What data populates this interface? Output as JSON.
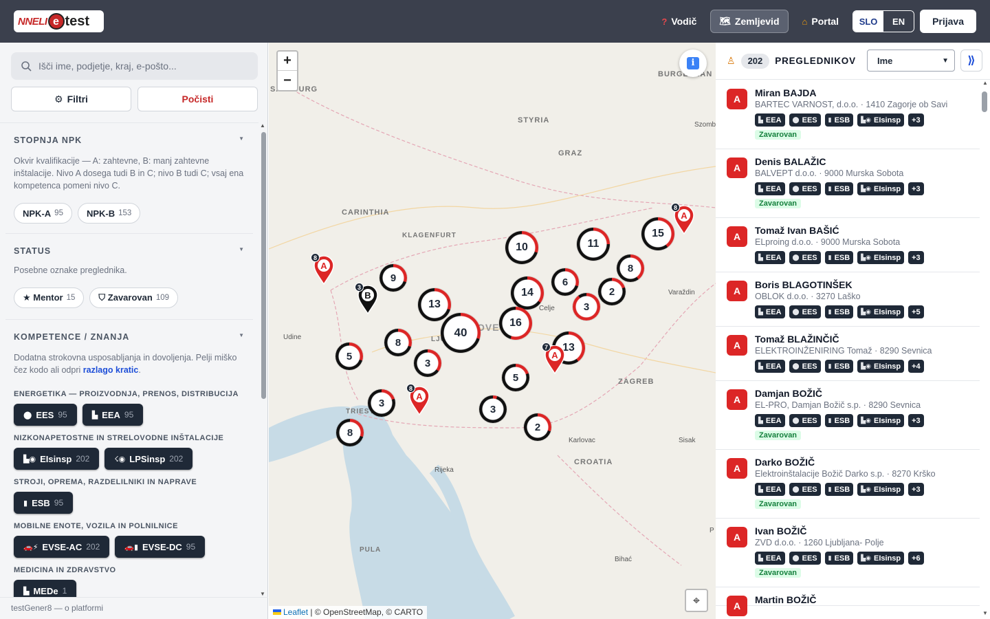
{
  "header": {
    "logo_text_1": "NNELI",
    "logo_pin": "e",
    "logo_text_2": "test",
    "nav": [
      {
        "label": "Vodič",
        "icon": "question-icon",
        "active": false
      },
      {
        "label": "Zemljevid",
        "icon": "map-icon",
        "active": true
      },
      {
        "label": "Portal",
        "icon": "home-icon",
        "active": false
      }
    ],
    "lang_active": "SLO",
    "lang_other": "EN",
    "login": "Prijava"
  },
  "sidebar": {
    "search_placeholder": "Išči ime, podjetje, kraj, e-pošto...",
    "filters_button": "Filtri",
    "clear_button": "Počisti",
    "npk": {
      "title": "STOPNJA NPK",
      "desc": "Okvir kvalifikacije — A: zahtevne, B: manj zahtevne inštalacije. Nivo A dosega tudi B in C; nivo B tudi C; vsaj ena kompetenca pomeni nivo C.",
      "chips": [
        {
          "label": "NPK-A",
          "count": "95"
        },
        {
          "label": "NPK-B",
          "count": "153"
        }
      ]
    },
    "status": {
      "title": "STATUS",
      "desc": "Posebne oznake preglednika.",
      "chips": [
        {
          "label": "★ Mentor",
          "count": "15"
        },
        {
          "label": "⛉ Zavarovan",
          "count": "109"
        }
      ]
    },
    "komp": {
      "title": "KOMPETENCE / ZNANJA",
      "desc_1": "Dodatna strokovna usposabljanja in dovoljenja. Pelji miško čez kodo ali odpri ",
      "desc_link": "razlago kratic",
      "desc_2": ".",
      "groups": [
        {
          "title": "ENERGETIKA — PROIZVODNJA, PRENOS, DISTRIBUCIJA",
          "items": [
            {
              "label": "EES",
              "count": "95"
            },
            {
              "label": "EEA",
              "count": "95"
            }
          ]
        },
        {
          "title": "NIZKONAPETOSTNE IN STRELOVODNE INŠTALACIJE",
          "items": [
            {
              "label": "EIsinsp",
              "count": "202"
            },
            {
              "label": "LPSinsp",
              "count": "202"
            }
          ]
        },
        {
          "title": "STROJI, OPREMA, RAZDELILNIKI IN NAPRAVE",
          "items": [
            {
              "label": "ESB",
              "count": "95"
            }
          ]
        },
        {
          "title": "MOBILNE ENOTE, VOZILA IN POLNILNICE",
          "items": [
            {
              "label": "EVSE-AC",
              "count": "202"
            },
            {
              "label": "EVSE-DC",
              "count": "95"
            }
          ]
        },
        {
          "title": "MEDICINA IN ZDRAVSTVO",
          "items": [
            {
              "label": "MEDe",
              "count": "1"
            }
          ]
        }
      ]
    },
    "footer": "testGener8 — o platformi"
  },
  "map": {
    "labels": [
      {
        "text": "SALZBURG"
      },
      {
        "text": "STYRIA"
      },
      {
        "text": "GRAZ"
      },
      {
        "text": "BURGENLAN"
      },
      {
        "text": "Szomb"
      },
      {
        "text": "CARINTHIA"
      },
      {
        "text": "KLAGENFURT"
      },
      {
        "text": "Varaždin"
      },
      {
        "text": "Udine"
      },
      {
        "text": "Celje"
      },
      {
        "text": "LJU"
      },
      {
        "text": "OVE"
      },
      {
        "text": "ZAGREB"
      },
      {
        "text": "TRIEST"
      },
      {
        "text": "Karlovac"
      },
      {
        "text": "Sisak"
      },
      {
        "text": "CROATIA"
      },
      {
        "text": "Rijeka"
      },
      {
        "text": "PULA"
      },
      {
        "text": "Bihać"
      },
      {
        "text": "P"
      }
    ],
    "clusters": [
      "10",
      "11",
      "15",
      "9",
      "13",
      "14",
      "6",
      "8",
      "2",
      "3",
      "40",
      "16",
      "8",
      "5",
      "3",
      "13",
      "5",
      "3",
      "3",
      "8",
      "2"
    ],
    "cluster_share_red": [
      0.3,
      0.25,
      0.4,
      0.3,
      0.3,
      0.35,
      0.3,
      0.4,
      0.2,
      0.9,
      0.3,
      0.55,
      0.3,
      0.3,
      0.35,
      0.4,
      0.2,
      0.2,
      0.05,
      0.3,
      0.3
    ],
    "markers": [
      {
        "letter": "A",
        "badge": "8",
        "color": "#dc2626"
      },
      {
        "letter": "A",
        "badge": "8",
        "color": "#dc2626"
      },
      {
        "letter": "B",
        "badge": "3",
        "color": "#111111"
      },
      {
        "letter": "A",
        "badge": "7",
        "color": "#dc2626"
      },
      {
        "letter": "A",
        "badge": "8",
        "color": "#dc2626"
      }
    ],
    "attribution_link": "Leaflet",
    "attribution_rest": " | © OpenStreetMap, © CARTO"
  },
  "panel": {
    "count": "202",
    "title": "PREGLEDNIKOV",
    "sort_value": "Ime",
    "collapse_label": "⟫",
    "items": [
      {
        "level": "A",
        "name": "Miran BAJDA",
        "sub": "BARTEC VARNOST, d.o.o. · 1410 Zagorje ob Savi",
        "more": "+3",
        "insured": "Zavarovan"
      },
      {
        "level": "A",
        "name": "Denis BALAŽIC",
        "sub": "BALVEPT d.o.o. · 9000 Murska Sobota",
        "more": "+3",
        "insured": "Zavarovan"
      },
      {
        "level": "A",
        "name": "Tomaž Ivan BAŠIĆ",
        "sub": "ELproing d.o.o. · 9000 Murska Sobota",
        "more": "+3",
        "insured": ""
      },
      {
        "level": "A",
        "name": "Boris BLAGOTINŠEK",
        "sub": "OBLOK d.o.o. · 3270 Laško",
        "more": "+5",
        "insured": ""
      },
      {
        "level": "A",
        "name": "Tomaž BLAŽINČIČ",
        "sub": "ELEKTROINŽENIRING Tomaž · 8290 Sevnica",
        "more": "+4",
        "insured": ""
      },
      {
        "level": "A",
        "name": "Damjan BOŽIČ",
        "sub": "EL-PRO, Damjan Božič s.p. · 8290 Sevnica",
        "more": "+3",
        "insured": "Zavarovan"
      },
      {
        "level": "A",
        "name": "Darko BOŽIČ",
        "sub": "Elektroinštalacije Božič Darko s.p. · 8270 Krško",
        "more": "+3",
        "insured": "Zavarovan"
      },
      {
        "level": "A",
        "name": "Ivan BOŽIČ",
        "sub": "ZVD d.o.o. · 1260 Ljubljana- Polje",
        "more": "+6",
        "insured": "Zavarovan"
      },
      {
        "level": "A",
        "name": "Martin BOŽIČ",
        "sub": "",
        "more": "",
        "insured": ""
      }
    ],
    "tags": [
      "EEA",
      "EES",
      "ESB",
      "EIsinsp"
    ]
  }
}
